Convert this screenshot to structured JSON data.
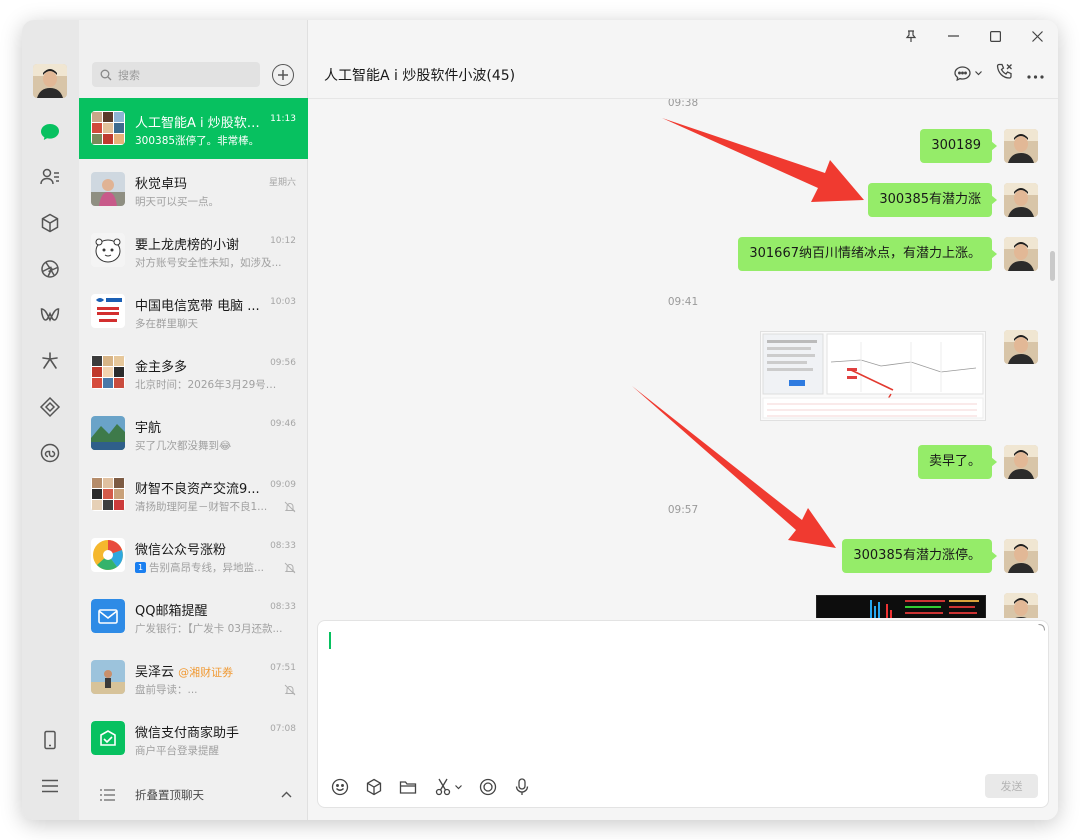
{
  "search": {
    "placeholder": "搜索"
  },
  "chats": [
    {
      "name": "人工智能A ⅰ 炒股软件小波(45)",
      "time": "11:13",
      "preview": "300385涨停了。非常棒。",
      "active": true
    },
    {
      "name": "秋觉卓玛",
      "time": "星期六",
      "preview": "明天可以买一点。"
    },
    {
      "name": "要上龙虎榜的小谢",
      "time": "10:12",
      "preview": "对方账号安全性未知，如涉及..."
    },
    {
      "name": "中国电信宽带 电脑 ...",
      "time": "10:03",
      "preview": "多在群里聊天"
    },
    {
      "name": "金主多多",
      "time": "09:56",
      "preview": "北京时间：2026年3月29号到..."
    },
    {
      "name": "宇航",
      "time": "09:46",
      "preview": "买了几次都没舞到😂"
    },
    {
      "name": "财智不良资产交流9...",
      "time": "09:09",
      "preview": "清扬助理阿星－财智不良1...",
      "muted": true
    },
    {
      "name": "微信公众号涨粉",
      "time": "08:33",
      "preview": "告别高昂专线，异地监...",
      "badge": "1",
      "muted": true
    },
    {
      "name": "QQ邮箱提醒",
      "time": "08:33",
      "preview": "广发银行：【广发卡 03月还款..."
    },
    {
      "name": "吴泽云",
      "tag": "@湘财证券",
      "time": "07:51",
      "preview": "盘前导读：...",
      "muted": true
    },
    {
      "name": "微信支付商家助手",
      "time": "07:08",
      "preview": "商户平台登录提醒"
    }
  ],
  "fold_label": "折叠置顶聊天",
  "conversation": {
    "title": "人工智能A ⅰ 炒股软件小波(45)",
    "times": [
      "09:38",
      "09:41",
      "09:57"
    ],
    "messages": [
      "300189",
      "300385有潜力涨",
      "301667纳百川情绪冰点，有潜力上涨。",
      "卖早了。",
      "300385有潜力涨停。"
    ]
  },
  "compose": {
    "send_label": "发送"
  },
  "colors": {
    "accent": "#07c160",
    "bubble": "#95ec69",
    "arrow": "#f03a30"
  }
}
